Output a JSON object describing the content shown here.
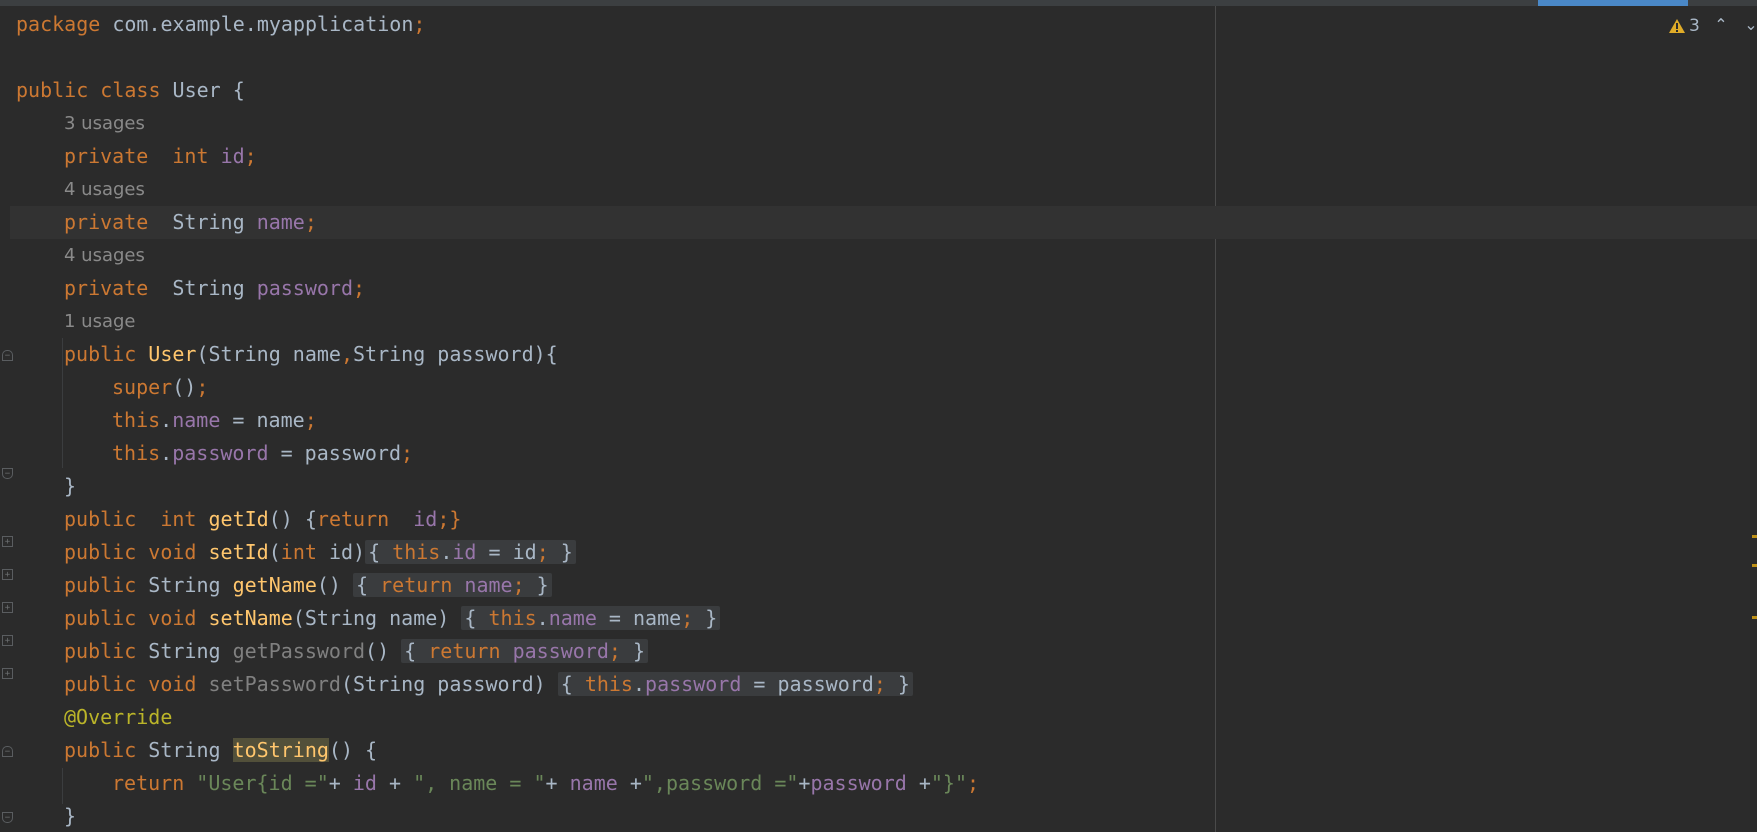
{
  "inspection": {
    "warning_count": "3",
    "warning_icon": "warning-triangle-icon",
    "nav_up_icon": "chevron-up-icon",
    "nav_down_icon": "chevron-down-icon"
  },
  "colors": {
    "background": "#2b2b2b",
    "keyword": "#cc7832",
    "field": "#9876aa",
    "method": "#ffc66d",
    "string": "#6a8759",
    "annotation": "#bbb529",
    "plain": "#a9b7c6",
    "hint": "#8a8a8a",
    "warning": "#be9117"
  },
  "code": {
    "l1": {
      "kw": "package",
      "rest": " com.example.myapplication",
      "semi": ";"
    },
    "l3": {
      "kw1": "public",
      "kw2": "class",
      "name": " User {"
    },
    "hint_id": "3 usages",
    "l5": {
      "kw": "private",
      "type": "int",
      "field": "id",
      "semi": ";"
    },
    "hint_name": "4 usages",
    "l7": {
      "kw": "private",
      "type": "String",
      "field": "name",
      "semi": ";"
    },
    "hint_password": "4 usages",
    "l9": {
      "kw": "private",
      "type": "String",
      "field": "password",
      "semi": ";"
    },
    "hint_ctor": "1 usage",
    "l11": {
      "kw": "public",
      "name": "User",
      "p1": "(String name",
      "comma": ",",
      "p2": "String password){"
    },
    "l12": {
      "kw": "super",
      "rest": "()",
      "semi": ";"
    },
    "l13": {
      "kw": "this",
      "dot": ".",
      "field": "name",
      "rest": " = name",
      "semi": ";"
    },
    "l14": {
      "kw": "this",
      "dot": ".",
      "field": "password",
      "rest": " = password",
      "semi": ";"
    },
    "l15": "}",
    "l16": {
      "kw": "public",
      "type": "int",
      "fn": "getId",
      "open": "() {",
      "ret": "return",
      "field": "id",
      "close": ";}"
    },
    "l17": {
      "kw": "public",
      "kw2": "void",
      "fn": "setId",
      "p1": "(",
      "ptype": "int",
      "p2": " id)",
      "b1": "{ ",
      "th": "this",
      "dot": ".",
      "field": "id",
      "rest": " = id",
      "semi": ";",
      "b2": " }"
    },
    "l18": {
      "kw": "public",
      "type": " String ",
      "fn": "getName",
      "p": "()",
      "b1": "{ ",
      "ret": "return",
      "field": "name",
      "semi": ";",
      "b2": " }"
    },
    "l19": {
      "kw": "public",
      "kw2": "void",
      "fn": "setName",
      "p": "(String name)",
      "b1": "{ ",
      "th": "this",
      "dot": ".",
      "field": "name",
      "rest": " = name",
      "semi": ";",
      "b2": " }"
    },
    "l20": {
      "kw": "public",
      "type": " String ",
      "fn": "getPassword",
      "p": "()",
      "b1": "{ ",
      "ret": "return",
      "field": "password",
      "semi": ";",
      "b2": " }"
    },
    "l21": {
      "kw": "public",
      "kw2": "void",
      "fn": "setPassword",
      "p": "(String password)",
      "b1": "{ ",
      "th": "this",
      "dot": ".",
      "field": "password",
      "rest": " = password",
      "semi": ";",
      "b2": " }"
    },
    "l22": "@Override",
    "l23": {
      "kw": "public",
      "type": " String ",
      "fn": "toString",
      "rest": "() {"
    },
    "l24": {
      "ret": "return",
      "s1": "\"User{id =\"",
      "op1": "+ ",
      "f1": "id",
      "op2": " + ",
      "s2": "\", name = \"",
      "op3": "+ ",
      "f2": "name",
      "op4": " +",
      "s3": "\",password =\"",
      "op5": "+",
      "f3": "password",
      "op6": " +",
      "s4": "\"}\"",
      "semi": ";"
    },
    "l25": "}"
  }
}
